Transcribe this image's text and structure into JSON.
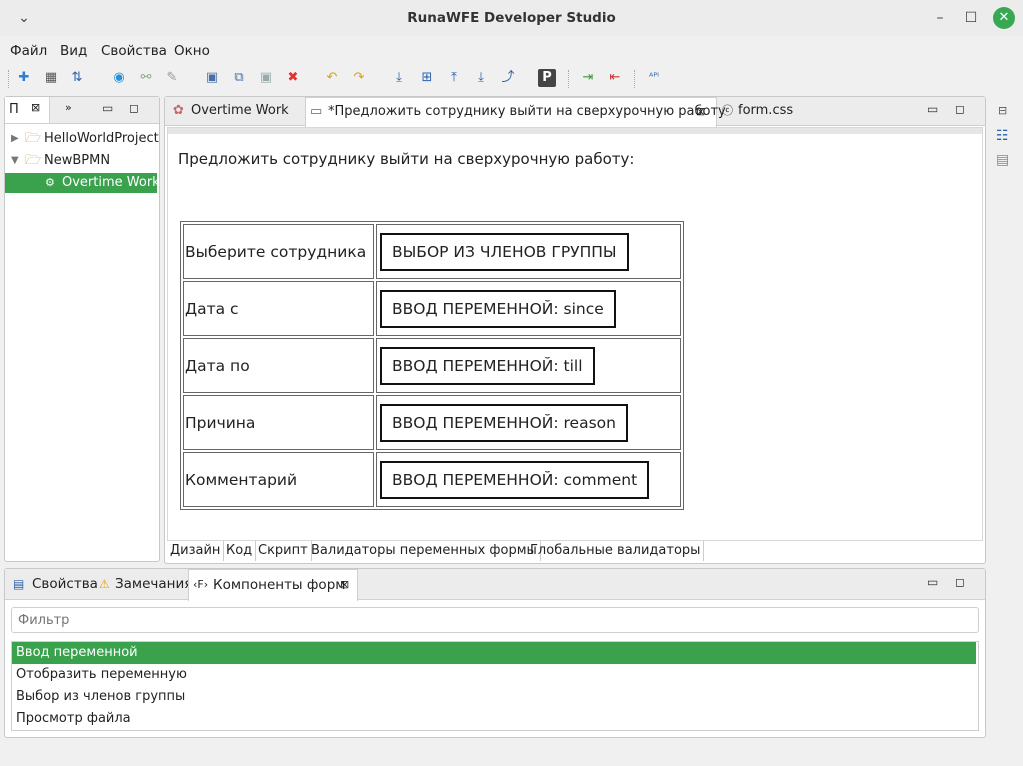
{
  "window": {
    "title": "RunaWFE Developer Studio"
  },
  "menu": [
    "Файл",
    "Вид",
    "Свойства",
    "Окно"
  ],
  "navigator": {
    "tab_label": "П",
    "items": [
      {
        "label": "HelloWorldProject",
        "expanded": false
      },
      {
        "label": "NewBPMN",
        "expanded": true
      },
      {
        "label": "Overtime Work",
        "selected": true
      }
    ]
  },
  "editor": {
    "tabs": [
      {
        "label": "Overtime Work"
      },
      {
        "label": "*Предложить сотруднику выйти на сверхурочную работу",
        "active": true
      },
      {
        "label": "form.css"
      }
    ],
    "heading": "Предложить сотруднику выйти на сверхурочную работу:",
    "rows": [
      {
        "label": "Выберите сотрудника",
        "component": "ВЫБОР ИЗ ЧЛЕНОВ ГРУППЫ"
      },
      {
        "label": "Дата с",
        "component": "ВВОД ПЕРЕМЕННОЙ: since"
      },
      {
        "label": "Дата по",
        "component": "ВВОД ПЕРЕМЕННОЙ: till"
      },
      {
        "label": "Причина",
        "component": "ВВОД ПЕРЕМЕННОЙ: reason"
      },
      {
        "label": "Комментарий",
        "component": "ВВОД ПЕРЕМЕННОЙ: comment"
      }
    ],
    "bottom_tabs": [
      "Дизайн",
      "Код",
      "Скрипт",
      "Валидаторы переменных формы",
      "Глобальные валидаторы"
    ]
  },
  "bottom_panel": {
    "tabs": [
      "Свойства",
      "Замечания",
      "Компоненты форм"
    ],
    "filter_placeholder": "Фильтр",
    "components": [
      "Ввод переменной",
      "Отобразить переменную",
      "Выбор из членов группы",
      "Просмотр файла"
    ]
  },
  "colors": {
    "accent": "#3aa14d"
  }
}
